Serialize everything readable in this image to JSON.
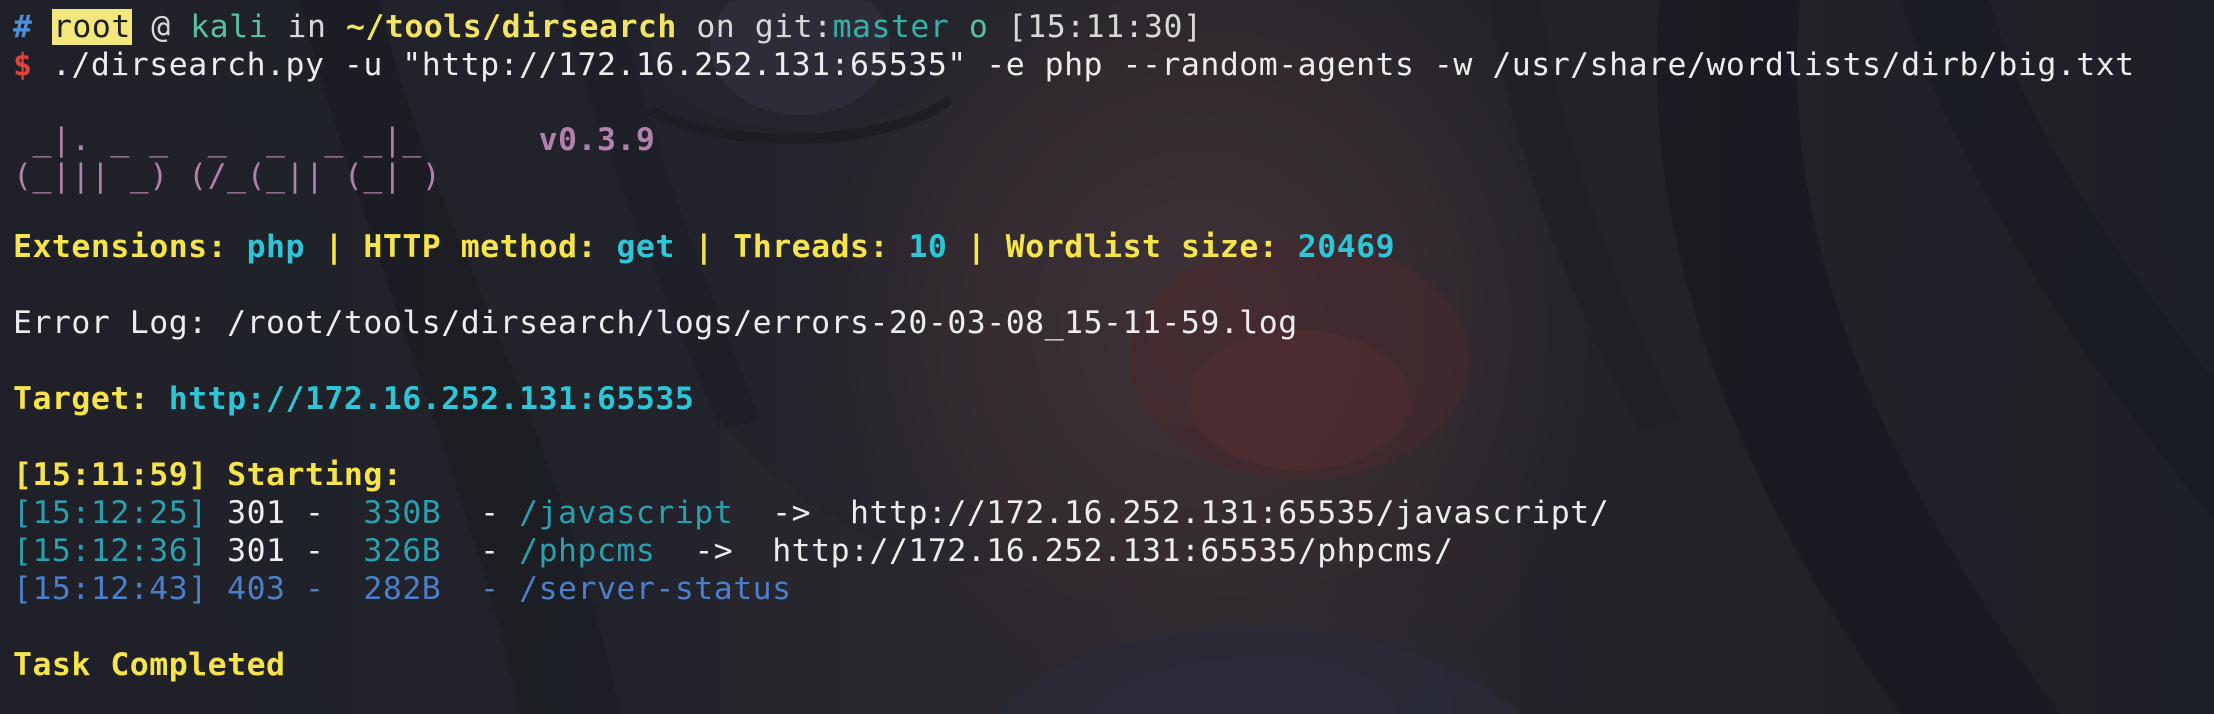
{
  "prompt": {
    "hash": "#",
    "user": "root",
    "at": "@",
    "host": "kali",
    "in": "in",
    "cwd": "~/tools/dirsearch",
    "on": "on",
    "git_prefix": "git:",
    "branch": "master",
    "git_status": "o",
    "time": "[15:11:30]"
  },
  "command": {
    "symbol": "$",
    "text": "./dirsearch.py -u \"http://172.16.252.131:65535\" -e php --random-agents -w /usr/share/wordlists/dirb/big.txt"
  },
  "banner": {
    "line1": " _|. _ _  _  _  _ _|_",
    "line2": "(_||| _) (/_(_|| (_| )",
    "version": "v0.3.9"
  },
  "config": {
    "extensions_label": "Extensions:",
    "extensions_value": "php",
    "http_method_label": "HTTP method:",
    "http_method_value": "get",
    "threads_label": "Threads:",
    "threads_value": "10",
    "wordlist_size_label": "Wordlist size:",
    "wordlist_size_value": "20469",
    "separator": "|"
  },
  "error_log": {
    "label": "Error Log:",
    "path": "/root/tools/dirsearch/logs/errors-20-03-08_15-11-59.log"
  },
  "target": {
    "label": "Target:",
    "url": "http://172.16.252.131:65535"
  },
  "start": {
    "time": "[15:11:59]",
    "label": "Starting:"
  },
  "results": [
    {
      "time": "[15:12:25]",
      "status": "301",
      "size": "330B",
      "path": "/javascript",
      "arrow": "->",
      "redirect": "http://172.16.252.131:65535/javascript/",
      "color": "#2b9fae"
    },
    {
      "time": "[15:12:36]",
      "status": "301",
      "size": "326B",
      "path": "/phpcms",
      "arrow": "->",
      "redirect": "http://172.16.252.131:65535/phpcms/",
      "color": "#2b9fae"
    },
    {
      "time": "[15:12:43]",
      "status": "403",
      "size": "282B",
      "path": "/server-status",
      "arrow": "",
      "redirect": "",
      "color": "#4b7fc9"
    }
  ],
  "footer": {
    "task_completed": "Task Completed"
  },
  "colors": {
    "prompt_hash": "#4f8fd6",
    "dollar": "#e0443a",
    "yellow": "#f6e44c",
    "cyan": "#2ec5d6",
    "purple": "#b081ad",
    "teal": "#2b9fae",
    "blue": "#4b7fc9"
  }
}
